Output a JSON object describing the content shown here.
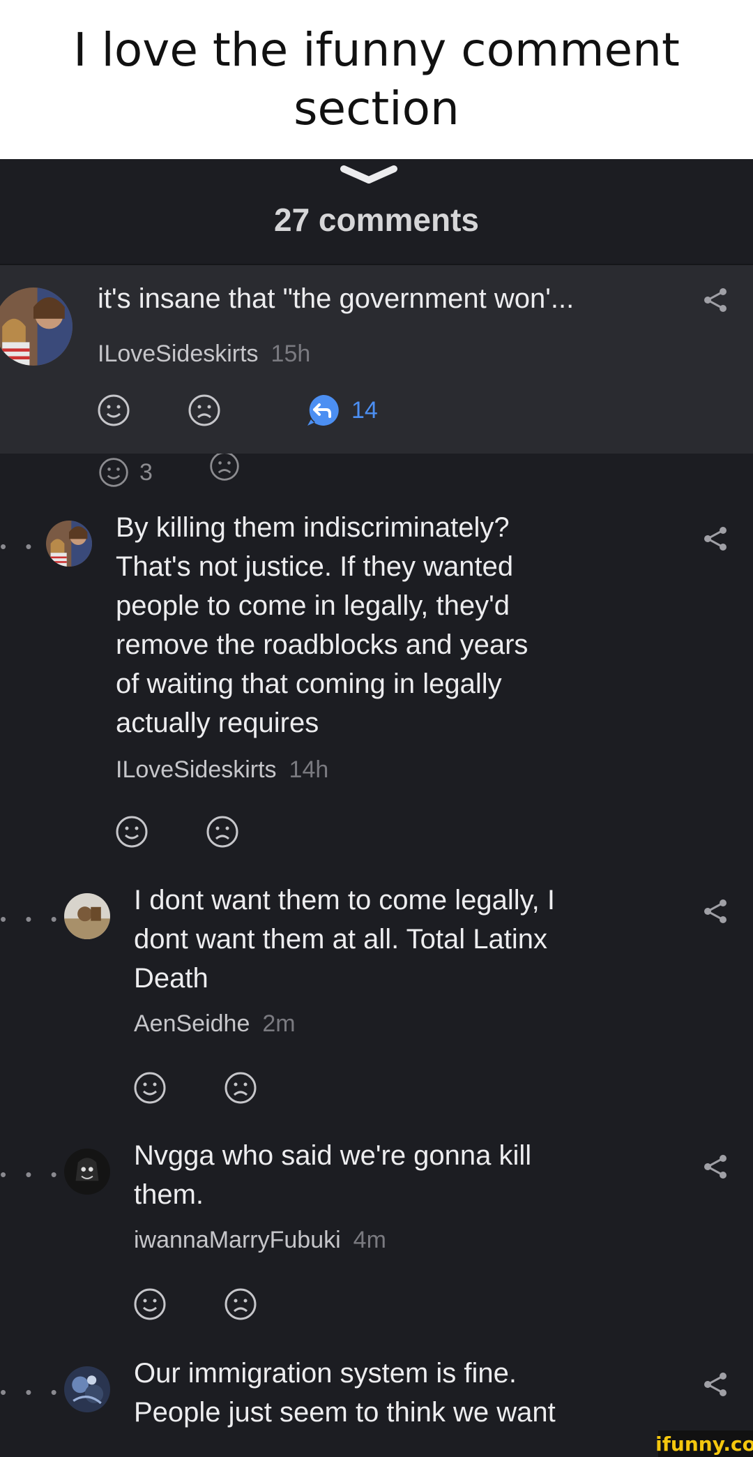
{
  "caption": "I love the ifunny comment section",
  "header": {
    "title": "27 comments"
  },
  "ghost_reactions": {
    "smile_count": "3"
  },
  "pinned": {
    "text": "it's insane that \"the government won'...",
    "author": "ILoveSideskirts",
    "time": "15h",
    "reply_count": "14"
  },
  "comments": [
    {
      "text_lines": [
        "By killing them indiscriminately?",
        "That's not justice. If they wanted",
        "people to come in legally, they'd",
        "remove the roadblocks and years",
        "of waiting that coming in legally",
        "actually requires"
      ],
      "author": "ILoveSideskirts",
      "time": "14h"
    },
    {
      "text_lines": [
        "I dont want them to come legally, I",
        "dont want them at all. Total Latinx",
        "Death"
      ],
      "author": "AenSeidhe",
      "time": "2m"
    },
    {
      "text_lines": [
        "Nvgga who said we're gonna kill",
        "them."
      ],
      "author": "iwannaMarryFubuki",
      "time": "4m"
    },
    {
      "text_lines": [
        "Our immigration system is fine.",
        "People just seem to think we want"
      ]
    }
  ],
  "watermark": "ifunny.co",
  "colors": {
    "background": "#1c1d22",
    "pinned_background": "#2a2b30",
    "accent": "#4c8ff2",
    "watermark": "#f4c70e"
  },
  "icons": [
    "chevron-down-icon",
    "smile-icon",
    "frown-icon",
    "share-icon",
    "reply-icon"
  ]
}
